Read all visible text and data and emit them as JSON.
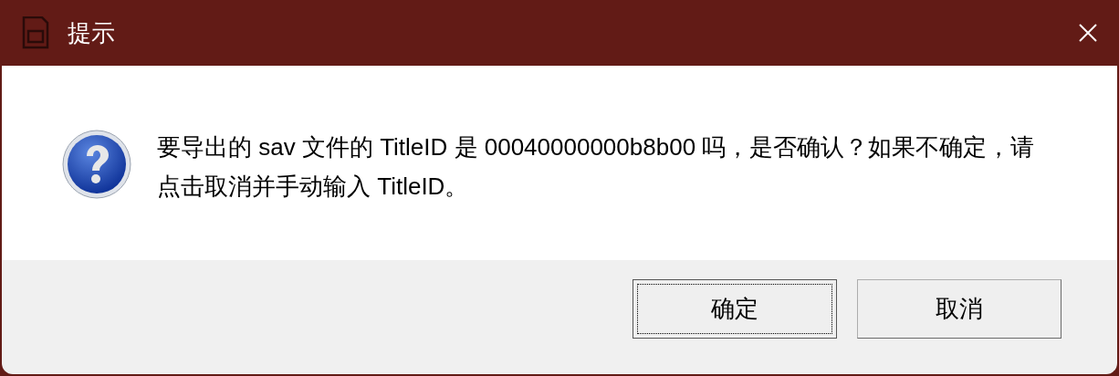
{
  "window": {
    "title": "提示"
  },
  "message": "要导出的 sav 文件的 TitleID 是 00040000000b8b00 吗，是否确认？如果不确定，请点击取消并手动输入 TitleID。",
  "buttons": [
    {
      "label": "确定",
      "default": true
    },
    {
      "label": "取消",
      "default": false
    }
  ]
}
